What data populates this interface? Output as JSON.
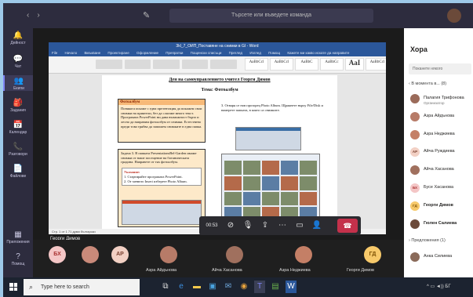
{
  "titlebar": {
    "search_placeholder": "Търсете или въведете команда"
  },
  "rail": [
    {
      "label": "Дейност",
      "icon": "bell-icon"
    },
    {
      "label": "Чат",
      "icon": "chat-icon"
    },
    {
      "label": "Екипи",
      "icon": "teams-icon"
    },
    {
      "label": "Задания",
      "icon": "assignments-icon"
    },
    {
      "label": "Календар",
      "icon": "calendar-icon"
    },
    {
      "label": "Разговори",
      "icon": "calls-icon"
    },
    {
      "label": "Файлове",
      "icon": "files-icon"
    },
    {
      "label": "Приложения",
      "icon": "apps-icon"
    },
    {
      "label": "Помощ",
      "icon": "help-icon"
    }
  ],
  "word": {
    "title": "3kl_7_ОИП_Поставяне на снимки в GI - Word",
    "tabs": [
      "File",
      "Начало",
      "Вмъкване",
      "Проектиране",
      "Оформление",
      "Препратки",
      "Пощенски списъци",
      "Преглед",
      "Изглед",
      "Помощ",
      "Кажете ми какво искате да направите"
    ],
    "styles": [
      "AaBbCcl",
      "AaBbCcl",
      "AaBbC",
      "AaBbCc",
      "AaI",
      "AaBbCcl"
    ],
    "status": "Стр. 1 от 1   71 думи   български"
  },
  "doc": {
    "heading": "Ден на самоуправлението    учител    Георги Димов",
    "topic": "Тема: Фотоалбум",
    "box_title": "Фотоалбум",
    "box_text": "Понякога искаме с една презентация да покажем свои снимки на приятели, без да слагаме много текст. Програмата PowerPoint ни дава възможност бързо и лесно да направим фотоалбум от снимки. Естествено преди това трябва да запишем снимките в една папка.",
    "step3": "3. Отваря се нов прозорец Photo Album. Щракнете върху File/Disk и намерете папката, в която са снимките.",
    "task_text": "Задача 3. В папката PresentationsBel-Garden имаме снимки от наше посещение на ботаническата градина. Направете от тях фотоалбум.",
    "note_title": "Указание:",
    "note_lines": [
      "1. Стартирайте програмата PowerPoint.",
      "2. От менюто Insert изберете Photo Album."
    ]
  },
  "presenter": "Георги Димов",
  "controls": {
    "timer": "00:53",
    "icons": [
      "camera-icon",
      "microphone-icon",
      "share-icon",
      "more-icon",
      "chat-icon",
      "participants-icon"
    ]
  },
  "strip": [
    {
      "initials": "БХ",
      "name": "",
      "color": "#f4c6c6",
      "fg": "#a33"
    },
    {
      "initials": "",
      "name": "",
      "color": "#c98a7a",
      "fg": "#fff"
    },
    {
      "initials": "АР",
      "name": "",
      "color": "#f2d0c4",
      "fg": "#7a4030"
    },
    {
      "initials": "",
      "name": "Азра Айдънова",
      "color": "#b77b68",
      "fg": "#fff"
    },
    {
      "initials": "",
      "name": "Айча Хасанова",
      "color": "#a0705e",
      "fg": "#fff"
    },
    {
      "initials": "",
      "name": "Азра Неджиева",
      "color": "#c47f66",
      "fg": "#fff"
    },
    {
      "initials": "",
      "name": "",
      "color": "#6b4a3a",
      "fg": "#fff"
    },
    {
      "initials": "ГД",
      "name": "Георги Димов",
      "color": "#f7c96a",
      "fg": "#7a4d00"
    }
  ],
  "people": {
    "title": "Хора",
    "search_placeholder": "Поканете някого",
    "in_meeting": "‹ В момента в...  (8)",
    "suggestions": "› Предложения (1)",
    "members": [
      {
        "name": "Палагия Трифонова",
        "sub": "Организатор",
        "initials": "",
        "color": "#9b6b5a",
        "fg": "#fff"
      },
      {
        "name": "Азра Айдънова",
        "sub": "",
        "initials": "",
        "color": "#b77b68",
        "fg": "#fff"
      },
      {
        "name": "Азра Неджиева",
        "sub": "",
        "initials": "",
        "color": "#c47f66",
        "fg": "#fff"
      },
      {
        "name": "Айча Руждиева",
        "sub": "",
        "initials": "АР",
        "color": "#f2d0c4",
        "fg": "#7a4030"
      },
      {
        "name": "Айча Хасанова",
        "sub": "",
        "initials": "",
        "color": "#a0705e",
        "fg": "#fff"
      },
      {
        "name": "Бусе Хасанова",
        "sub": "",
        "initials": "БХ",
        "color": "#f4c6c6",
        "fg": "#a33"
      },
      {
        "name": "Георги Димов",
        "sub": "",
        "initials": "ГД",
        "color": "#f7c96a",
        "fg": "#7a4d00"
      },
      {
        "name": "Гюлен Салиева",
        "sub": "",
        "initials": "",
        "color": "#6b4a3a",
        "fg": "#fff"
      }
    ],
    "suggested": [
      {
        "name": "Анка Силиева",
        "initials": "",
        "color": "#8a6a5a",
        "fg": "#fff"
      }
    ]
  },
  "taskbar": {
    "search_placeholder": "Type here to search",
    "apps": [
      "task-view-icon",
      "edge-icon",
      "explorer-icon",
      "store-icon",
      "mail-icon",
      "chrome-icon",
      "teams-icon",
      "paint-icon",
      "word-icon"
    ]
  }
}
